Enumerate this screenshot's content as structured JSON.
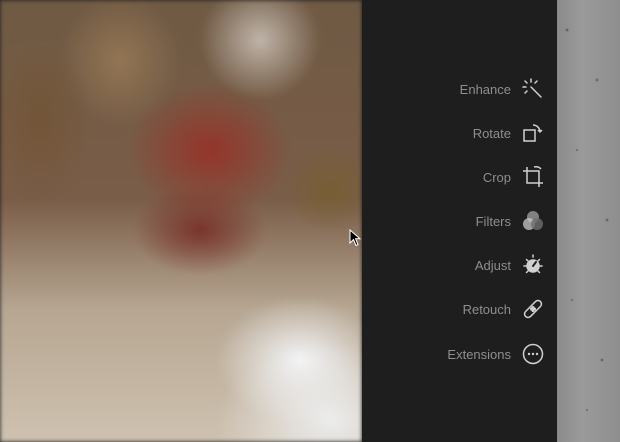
{
  "menu": {
    "items": [
      {
        "label": "Enhance",
        "icon": "magic-wand-icon"
      },
      {
        "label": "Rotate",
        "icon": "rotate-icon"
      },
      {
        "label": "Crop",
        "icon": "crop-icon"
      },
      {
        "label": "Filters",
        "icon": "filters-icon"
      },
      {
        "label": "Adjust",
        "icon": "adjust-dial-icon"
      },
      {
        "label": "Retouch",
        "icon": "bandage-icon"
      },
      {
        "label": "Extensions",
        "icon": "more-icon"
      }
    ]
  },
  "colors": {
    "panel_bg": "#1e1e1e",
    "label": "#8e8e8e",
    "icon": "#d0d0d0"
  }
}
